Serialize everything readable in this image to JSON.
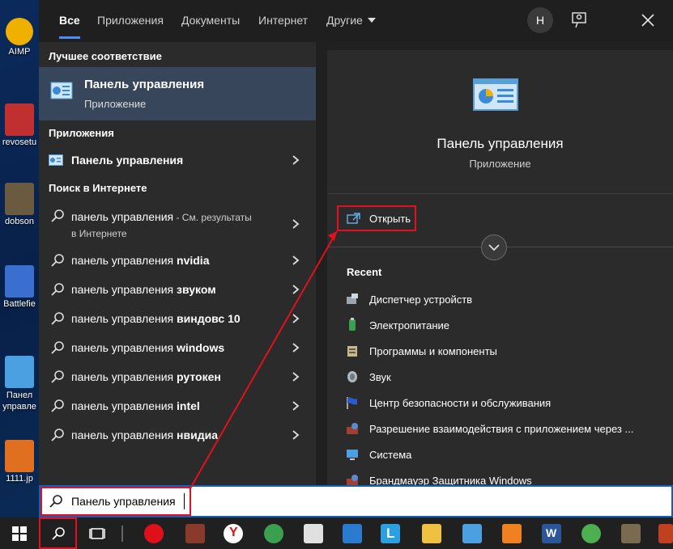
{
  "desktop": {
    "icons": [
      {
        "label": "AIMP",
        "color": "#f0b000"
      },
      {
        "label": "revosetu",
        "color": "#c03030"
      },
      {
        "label": "dobson",
        "color": "#6a5a40"
      },
      {
        "label": "Battlefie",
        "color": "#3a6fd0"
      },
      {
        "label": "Панел управле",
        "color": "#4aa0e0"
      },
      {
        "label": "1111.jp",
        "color": "#e07020"
      }
    ]
  },
  "tabs": [
    {
      "label": "Все",
      "active": true
    },
    {
      "label": "Приложения",
      "active": false
    },
    {
      "label": "Документы",
      "active": false
    },
    {
      "label": "Интернет",
      "active": false
    },
    {
      "label": "Другие",
      "active": false
    }
  ],
  "header": {
    "avatar_letter": "Н"
  },
  "left": {
    "best_match_heading": "Лучшее соответствие",
    "best_match": {
      "title": "Панель управления",
      "subtitle": "Приложение"
    },
    "apps_heading": "Приложения",
    "app_item": "Панель управления",
    "web_heading": "Поиск в Интернете",
    "web_first": {
      "query": "панель управления",
      "suffix": " - См. результаты",
      "suffix2": "в Интернете"
    },
    "suggestions": [
      {
        "prefix": "панель управления ",
        "bold": "nvidia"
      },
      {
        "prefix": "панель управления ",
        "bold": "звуком"
      },
      {
        "prefix": "панель управления ",
        "bold": "виндовс 10"
      },
      {
        "prefix": "панель управления ",
        "bold": "windows"
      },
      {
        "prefix": "панель управления ",
        "bold": "рутокен"
      },
      {
        "prefix": "панель управления ",
        "bold": "intel"
      },
      {
        "prefix": "панель управления ",
        "bold": "нвидиа"
      }
    ]
  },
  "right": {
    "title": "Панель управления",
    "subtitle": "Приложение",
    "open_label": "Открыть",
    "recent_heading": "Recent",
    "recent": [
      {
        "label": "Диспетчер устройств",
        "icon": "device-manager-icon"
      },
      {
        "label": "Электропитание",
        "icon": "power-icon"
      },
      {
        "label": "Программы и компоненты",
        "icon": "programs-icon"
      },
      {
        "label": "Звук",
        "icon": "sound-icon"
      },
      {
        "label": "Центр безопасности и обслуживания",
        "icon": "flag-icon"
      },
      {
        "label": "Разрешение взаимодействия с приложением через ...",
        "icon": "firewall-icon"
      },
      {
        "label": "Система",
        "icon": "system-icon"
      },
      {
        "label": "Брандмауэр Защитника Windows",
        "icon": "firewall-icon"
      }
    ]
  },
  "search": {
    "value": "Панель управления"
  },
  "taskbar": {
    "apps": [
      {
        "name": "opera",
        "color": "#e0101a"
      },
      {
        "name": "winrar",
        "color": "#8a3a2a"
      },
      {
        "name": "yandex",
        "color": "#ffffff"
      },
      {
        "name": "shield",
        "color": "#3aa050"
      },
      {
        "name": "cursor-app",
        "color": "#e0e0e0"
      },
      {
        "name": "mail",
        "color": "#2a7ad0"
      },
      {
        "name": "l-app",
        "color": "#2aa0e0"
      },
      {
        "name": "explorer",
        "color": "#f0c040"
      },
      {
        "name": "control-panel",
        "color": "#4aa0e0"
      },
      {
        "name": "sublime",
        "color": "#f08020"
      },
      {
        "name": "word",
        "color": "#2b579a"
      },
      {
        "name": "chrome",
        "color": "#4caf50"
      },
      {
        "name": "media",
        "color": "#7a6a50"
      },
      {
        "name": "winrar2",
        "color": "#c04020"
      }
    ]
  },
  "colors": {
    "accent": "#4c8cf6",
    "highlight": "#e3101d",
    "panel": "#2b2b2b",
    "selected": "#37465a"
  }
}
